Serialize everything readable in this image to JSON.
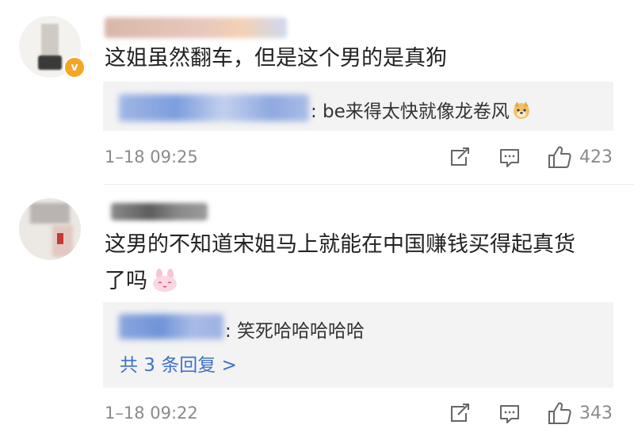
{
  "comments": [
    {
      "text": "这姐虽然翻车，但是这个男的是真狗",
      "reply": {
        "text": ": be来得太快就像龙卷风",
        "emoji": "dog-emoji"
      },
      "timestamp": "1–18 09:25",
      "likes": "423",
      "verified_badge": "v"
    },
    {
      "text_line1": "这男的不知道宋姐马上就能在中国赚钱买得起真货",
      "text_line2": "了吗",
      "reply": {
        "text": ": 笑死哈哈哈哈哈"
      },
      "more_replies": "共 3 条回复 >",
      "timestamp": "1–18 09:22",
      "likes": "343"
    }
  ],
  "colors": {
    "link": "#3f72c9",
    "meta": "#8a8a8a",
    "reply_bg": "#f3f3f3",
    "badge": "#f5a623"
  }
}
